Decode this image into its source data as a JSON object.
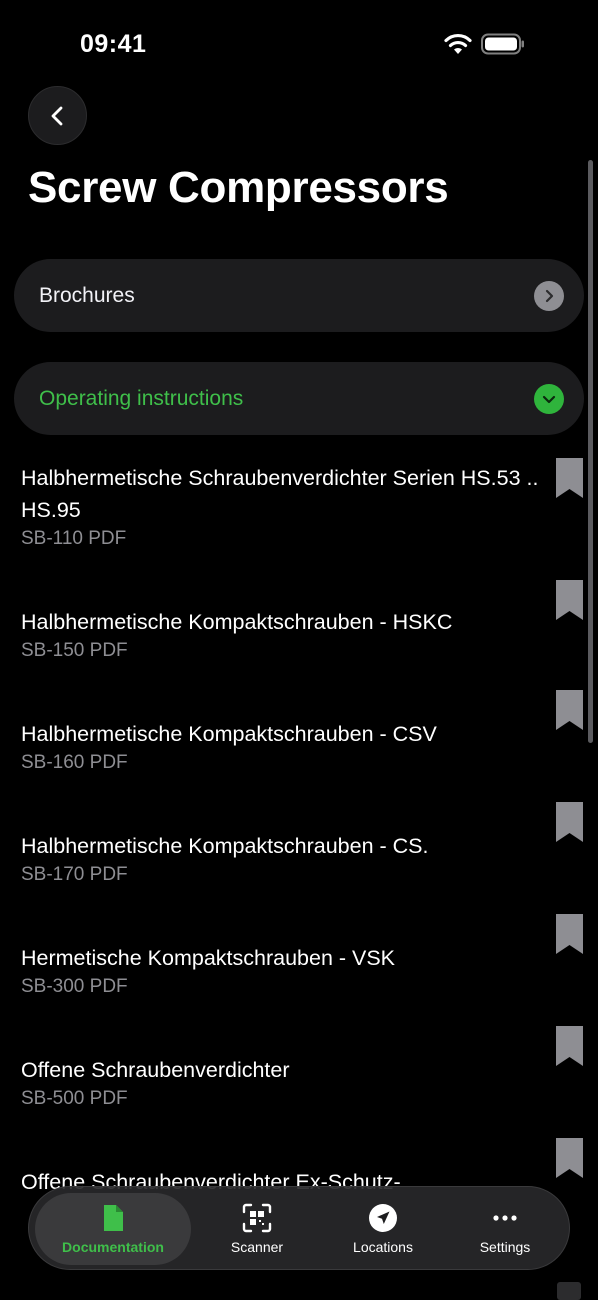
{
  "status": {
    "time": "09:41"
  },
  "header": {
    "title": "Screw Compressors"
  },
  "sections": {
    "brochures": {
      "label": "Brochures"
    },
    "operating": {
      "label": "Operating instructions"
    }
  },
  "documents": [
    {
      "title": "Halbhermetische Schraubenverdichter Serien HS.53 .. HS.95",
      "subtitle": "SB-110 PDF"
    },
    {
      "title": "Halbhermetische Kompaktschrauben - HSKC",
      "subtitle": "SB-150 PDF"
    },
    {
      "title": "Halbhermetische Kompaktschrauben - CSV",
      "subtitle": "SB-160 PDF"
    },
    {
      "title": "Halbhermetische Kompaktschrauben - CS.",
      "subtitle": "SB-170 PDF"
    },
    {
      "title": "Hermetische Kompaktschrauben - VSK",
      "subtitle": "SB-300 PDF"
    },
    {
      "title": "Offene Schraubenverdichter",
      "subtitle": "SB-500 PDF"
    },
    {
      "title": "Offene Schraubenverdichter Ex-Schutz-",
      "subtitle": ""
    }
  ],
  "tabs": {
    "documentation": "Documentation",
    "scanner": "Scanner",
    "locations": "Locations",
    "settings": "Settings"
  },
  "colors": {
    "accent": "#3fbf4a",
    "background": "#000000",
    "card": "#1c1c1e"
  }
}
